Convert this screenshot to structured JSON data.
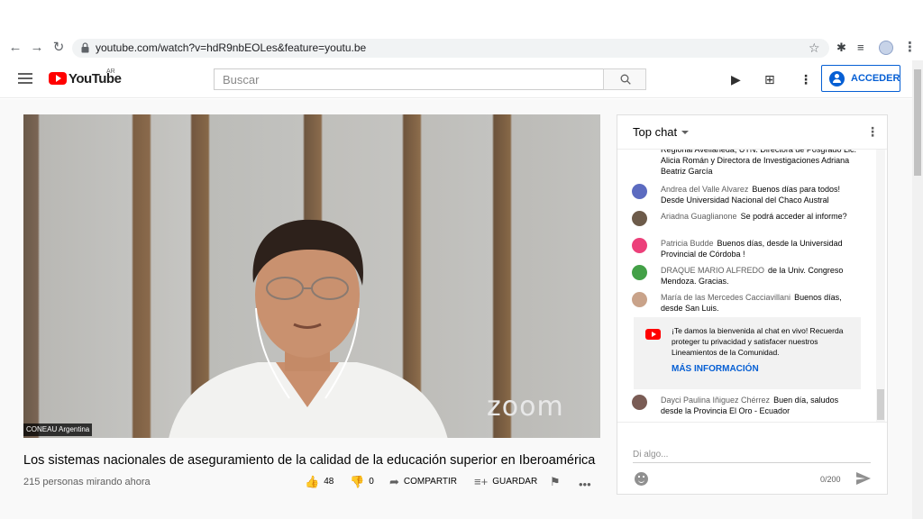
{
  "browser": {
    "url": "youtube.com/watch?v=hdR9nbEOLes&feature=youtu.be",
    "back_icon": "arrow-left",
    "forward_icon": "arrow-right",
    "reload_icon": "reload",
    "back_glyph": "←",
    "forward_glyph": "→",
    "reload_glyph": "↻",
    "star_glyph": "☆",
    "ext1_glyph": "✱",
    "ext2_glyph": "≡",
    "menu_glyph": "⋮"
  },
  "header": {
    "logo_text": "YouTube",
    "logo_region": "AR",
    "search_placeholder": "Buscar",
    "signin_label": "ACCEDER",
    "video_icon_glyph": "▶",
    "apps_icon_glyph": "⊞",
    "menu_glyph": "⋮"
  },
  "video": {
    "watermark": "zoom",
    "caption": "CONEAU Argentina",
    "title": "Los sistemas nacionales de aseguramiento de la calidad de la educación superior en Iberoamérica",
    "viewers": "215 personas mirando ahora"
  },
  "actions": {
    "likes": "48",
    "dislikes": "0",
    "share_label": "COMPARTIR",
    "save_label": "GUARDAR",
    "like_glyph": "👍",
    "dislike_glyph": "👎",
    "share_glyph": "➦",
    "save_glyph": "≡+",
    "flag_glyph": "⚑",
    "more_glyph": "•••"
  },
  "chat": {
    "mode": "Top chat",
    "menu_glyph": "⋮",
    "messages": [
      {
        "author": "",
        "text": "Regional Avellaneda, UTN. Directora de Posgrado Lic. Alicia Román y Directora de Investigaciones Adriana Beatriz García",
        "avatar_color": ""
      },
      {
        "author": "Andrea del Valle Alvarez",
        "text": "Buenos días para todos! Desde Universidad Nacional del Chaco Austral",
        "avatar_color": "#5c6bc0"
      },
      {
        "author": "Ariadna Guaglianone",
        "text": "Se podrá acceder al informe?",
        "avatar_color": "#6d5b4a"
      },
      {
        "author": "Patricia Budde",
        "text": "Buenos días, desde la Universidad Provincial de Córdoba !",
        "avatar_color": "#ec407a"
      },
      {
        "author": "DRAQUE MARIO ALFREDO",
        "text": "de la Univ. Congreso Mendoza. Gracias.",
        "avatar_color": "#43a047"
      },
      {
        "author": "María de las Mercedes Cacciavillani",
        "text": "Buenos días, desde San Luis.",
        "avatar_color": "#c9a38a"
      },
      {
        "author": "Dayci Paulina Iñiguez Chérrez",
        "text": "Buen día, saludos desde la Provincia El Oro - Ecuador",
        "avatar_color": "#7a5c55"
      }
    ],
    "welcome": {
      "text": "¡Te damos la bienvenida al chat en vivo! Recuerda proteger tu privacidad y satisfacer nuestros Lineamientos de la Comunidad.",
      "link": "MÁS INFORMACIÓN"
    },
    "input_placeholder": "Di algo...",
    "char_count": "0/200"
  }
}
